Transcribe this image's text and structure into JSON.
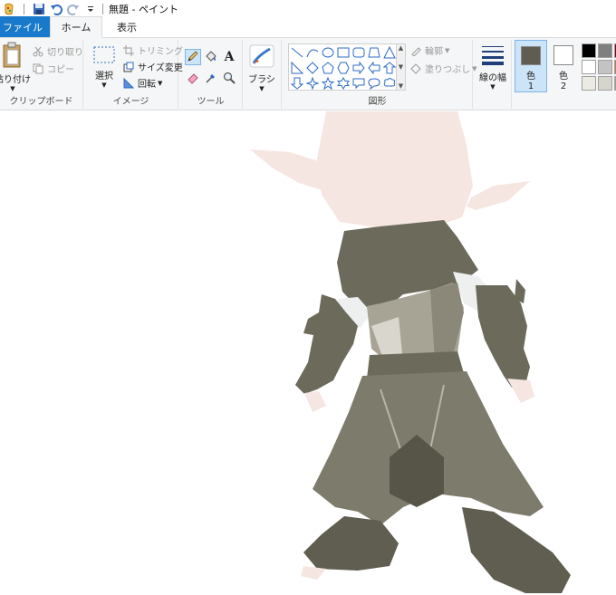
{
  "window": {
    "title": "無題 - ペイント"
  },
  "quick_access": {
    "icons": [
      "paint-app-icon",
      "save-icon",
      "undo-icon",
      "redo-icon",
      "customize-dropdown-icon"
    ]
  },
  "tabs": [
    {
      "label": "ファイル"
    },
    {
      "label": "ホーム"
    },
    {
      "label": "表示"
    }
  ],
  "ribbon": {
    "clipboard": {
      "label": "クリップボード",
      "paste": "貼り付け",
      "cut": "切り取り",
      "copy": "コピー"
    },
    "image": {
      "label": "イメージ",
      "select": "選択",
      "crop": "トリミング",
      "resize": "サイズ変更",
      "rotate": "回転"
    },
    "tools": {
      "label": "ツール"
    },
    "brushes": {
      "label": "ブラシ"
    },
    "shapes": {
      "label": "図形",
      "outline": "輪郭",
      "fill": "塗りつぶし"
    },
    "size": {
      "label": "線の幅"
    },
    "colors": {
      "color1_label": "色",
      "color1_num": "1",
      "color2_label": "色",
      "color2_num": "2",
      "color1_value": "#5f5d52",
      "color2_value": "#ffffff",
      "palette": [
        "#000000",
        "#7f7f7f",
        "#880015",
        "#ffffff",
        "#c3c3c3",
        "#b97a57",
        "#ebeae3",
        "#d6d5cc",
        "#a09e92"
      ]
    }
  },
  "drawing": {
    "colors": {
      "skin": "#f5e6e2",
      "cloth_dark": "#6b6a5b",
      "cloth_mid": "#7c7b6c",
      "cloth_light": "#a7a395",
      "highlight": "#d8d6cd",
      "white_part": "#eef0f0",
      "shadow": "#565548",
      "trim": "#b8b4a6"
    }
  }
}
